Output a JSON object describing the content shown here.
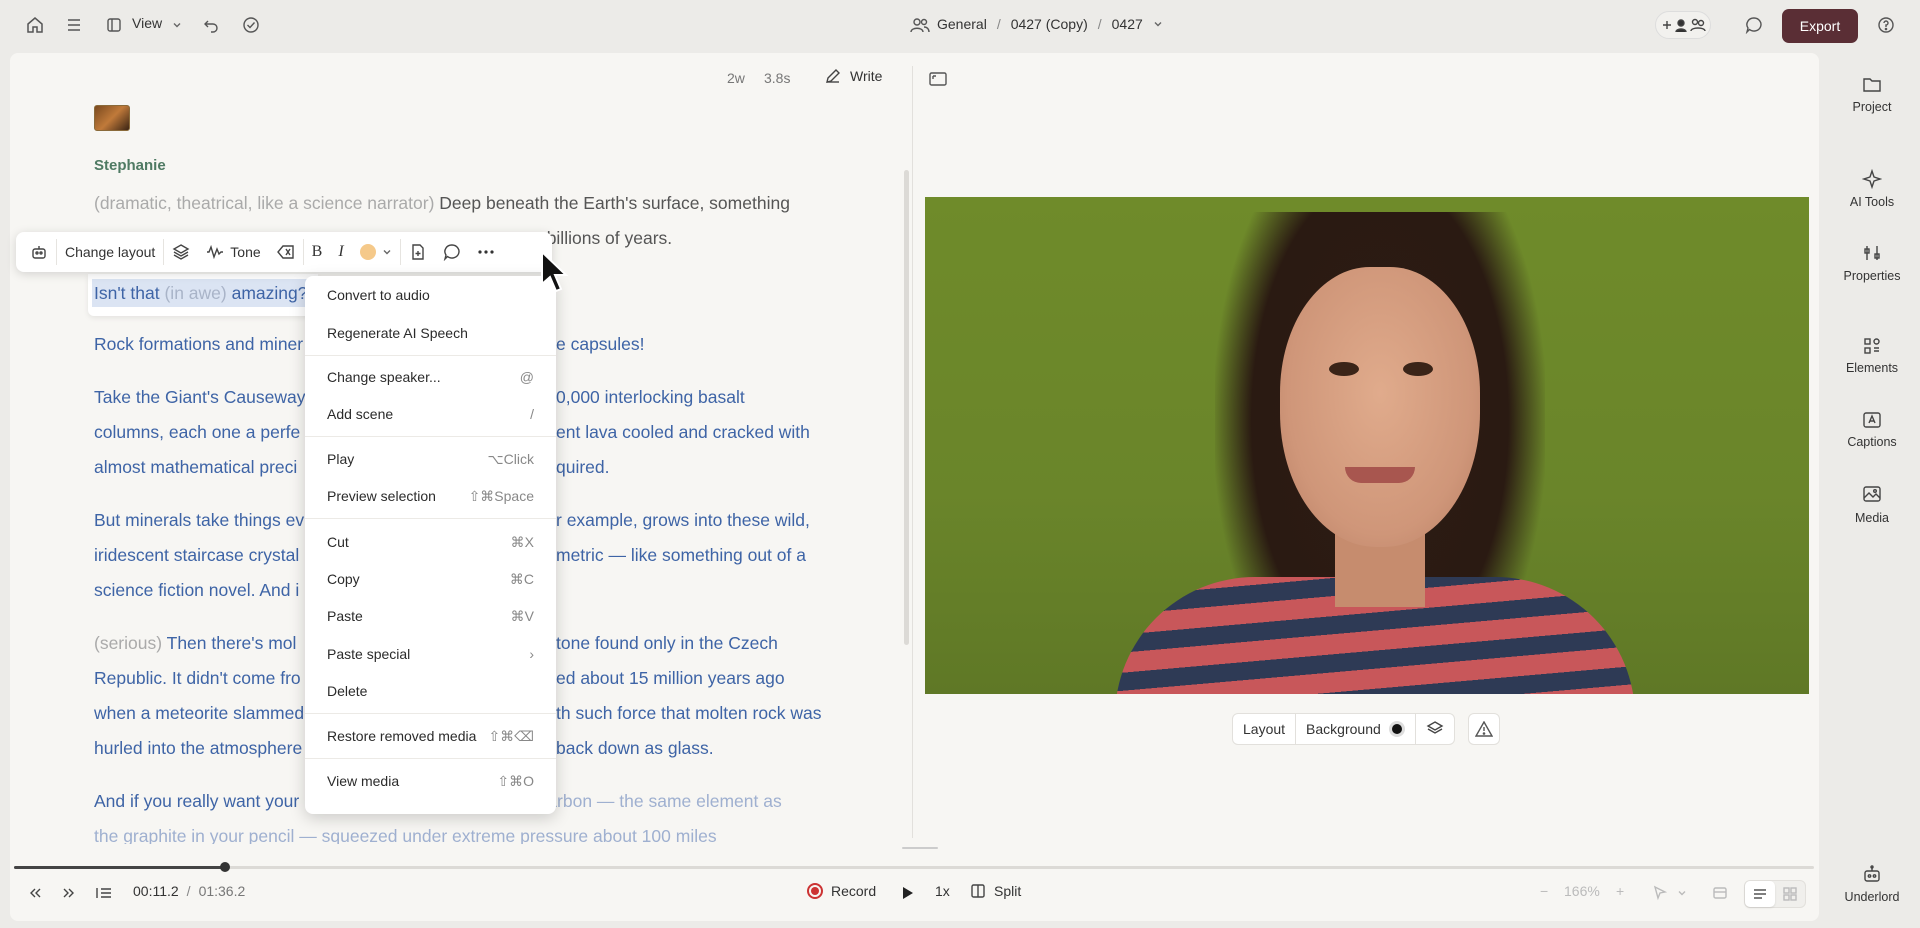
{
  "topbar": {
    "view_label": "View",
    "breadcrumb": [
      "General",
      "0427 (Copy)",
      "0427"
    ],
    "export_label": "Export"
  },
  "editor": {
    "word_count": "2w",
    "duration": "3.8s",
    "write_label": "Write",
    "speaker": "Stephanie",
    "paragraphs": {
      "p1_direction": "(dramatic, theatrical, like a science narrator)",
      "p1_text": "Deep beneath the Earth's surface, something",
      "p1_line2": "r billions of years.",
      "p2_text": "Isn't that",
      "p2_direction": "(in awe)",
      "p2_text2": "amazing?",
      "p3_a": "Rock formations and miner",
      "p3_b": "e capsules!",
      "p4_l1a": "Take the Giant's Causeway",
      "p4_l1b": "0,000 interlocking basalt",
      "p4_l2a": "columns, each one a perfe",
      "p4_l2b": "ent lava cooled and cracked with",
      "p4_l3a": "almost mathematical preci",
      "p4_l3b": "quired.",
      "p5_l1a": "But minerals take things ev",
      "p5_l1b": "r example, grows into these wild,",
      "p5_l2a": "iridescent staircase crystal",
      "p5_l2b": "metric — like something out of a",
      "p5_l3a": "science fiction novel. And i",
      "p6_direction": "(serious)",
      "p6_l1a": "Then there's mol",
      "p6_l1b": "tone found only in the Czech",
      "p6_l2a": "Republic. It didn't come fro",
      "p6_l2b": "ed about 15 million years ago",
      "p6_l3a": "when a meteorite slammed",
      "p6_l3b": "th such force that molten rock was",
      "p6_l4a": "hurled into the atmosphere",
      "p6_l4b": "back down as glass.",
      "p7_l1a": "And if you really want your",
      "p7_l1b": "mind blown: a diamond is just carbon — the same element as",
      "p7_l2": "the graphite in your pencil — squeezed under extreme pressure about 100 miles"
    }
  },
  "toolbar": {
    "change_layout": "Change layout",
    "tone": "Tone",
    "highlight_color": "#f5c98a"
  },
  "context_menu": {
    "items": [
      {
        "label": "Convert to audio",
        "shortcut": ""
      },
      {
        "label": "Regenerate AI Speech",
        "shortcut": ""
      },
      {
        "label": "Change speaker...",
        "shortcut": "@"
      },
      {
        "label": "Add scene",
        "shortcut": "/"
      },
      {
        "label": "Play",
        "shortcut": "⌥Click"
      },
      {
        "label": "Preview selection",
        "shortcut": "⇧⌘Space"
      },
      {
        "label": "Cut",
        "shortcut": "⌘X"
      },
      {
        "label": "Copy",
        "shortcut": "⌘C"
      },
      {
        "label": "Paste",
        "shortcut": "⌘V"
      },
      {
        "label": "Paste special",
        "shortcut": "›"
      },
      {
        "label": "Delete",
        "shortcut": ""
      },
      {
        "label": "Restore removed media",
        "shortcut": "⇧⌘⌫"
      },
      {
        "label": "View media",
        "shortcut": "⇧⌘O"
      }
    ]
  },
  "preview": {
    "layout_label": "Layout",
    "background_label": "Background"
  },
  "sidebar": {
    "items": [
      {
        "label": "Project",
        "icon": "folder-icon"
      },
      {
        "label": "AI Tools",
        "icon": "sparkle-icon"
      },
      {
        "label": "Properties",
        "icon": "sliders-icon"
      },
      {
        "label": "Elements",
        "icon": "elements-icon"
      },
      {
        "label": "Captions",
        "icon": "captions-icon"
      },
      {
        "label": "Media",
        "icon": "media-icon"
      },
      {
        "label": "Underlord",
        "icon": "robot-icon"
      }
    ]
  },
  "transport": {
    "current_time": "00:11.2",
    "total_time": "01:36.2",
    "record_label": "Record",
    "speed": "1x",
    "split_label": "Split",
    "zoom": "166%",
    "progress": 0.117
  }
}
